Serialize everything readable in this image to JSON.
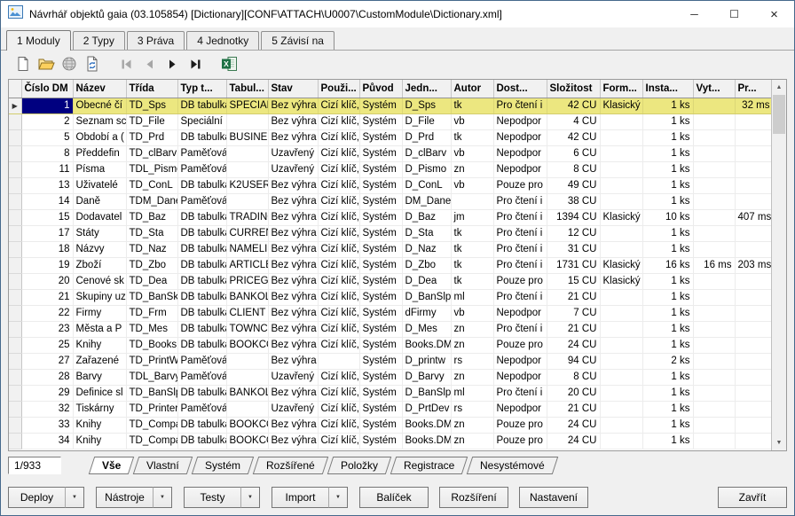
{
  "window": {
    "title": "Návrhář objektů gaia (03.105854) [Dictionary][CONF\\ATTACH\\U0007\\CustomModule\\Dictionary.xml]",
    "minimize": "─",
    "maximize": "☐",
    "close": "×"
  },
  "top_tabs": [
    {
      "label": "1 Moduly",
      "active": true
    },
    {
      "label": "2 Typy",
      "active": false
    },
    {
      "label": "3 Práva",
      "active": false
    },
    {
      "label": "4 Jednotky",
      "active": false
    },
    {
      "label": "5 Závisí na",
      "active": false
    }
  ],
  "toolbar": [
    {
      "name": "new-document-icon",
      "type": "new",
      "enabled": true
    },
    {
      "name": "open-folder-icon",
      "type": "open",
      "enabled": true
    },
    {
      "name": "globe-icon",
      "type": "globe",
      "enabled": true
    },
    {
      "name": "refresh-document-icon",
      "type": "refresh",
      "enabled": true
    },
    {
      "name": "nav-first-icon",
      "type": "first",
      "enabled": false
    },
    {
      "name": "nav-prev-icon",
      "type": "prev",
      "enabled": false
    },
    {
      "name": "nav-next-icon",
      "type": "next",
      "enabled": true
    },
    {
      "name": "nav-last-icon",
      "type": "last",
      "enabled": true
    },
    {
      "name": "excel-export-icon",
      "type": "excel",
      "enabled": true
    }
  ],
  "grid": {
    "columns": [
      {
        "label": "Číslo DM",
        "align": "right",
        "width": 58
      },
      {
        "label": "Název",
        "align": "left",
        "width": 60
      },
      {
        "label": "Třída",
        "align": "left",
        "width": 58
      },
      {
        "label": "Typ t...",
        "align": "left",
        "width": 55
      },
      {
        "label": "Tabul...",
        "align": "left",
        "width": 47
      },
      {
        "label": "Stav",
        "align": "left",
        "width": 56
      },
      {
        "label": "Použi...",
        "align": "left",
        "width": 47
      },
      {
        "label": "Původ",
        "align": "left",
        "width": 48
      },
      {
        "label": "Jedn...",
        "align": "left",
        "width": 55
      },
      {
        "label": "Autor",
        "align": "left",
        "width": 48
      },
      {
        "label": "Dost...",
        "align": "left",
        "width": 60
      },
      {
        "label": "Složitost",
        "align": "right",
        "width": 60
      },
      {
        "label": "Form...",
        "align": "left",
        "width": 48
      },
      {
        "label": "Insta...",
        "align": "right",
        "width": 57
      },
      {
        "label": "Vyt...",
        "align": "right",
        "width": 47
      },
      {
        "label": "Pr...",
        "align": "right",
        "width": 43
      }
    ],
    "selected_row": 0,
    "rows": [
      [
        "1",
        "Obecné čí",
        "TD_Sps",
        "DB tabulka",
        "SPECIALS",
        "Bez výhra",
        "Cizí klíč,Při",
        "Systém",
        "D_Sps",
        "tk",
        "Pro čtení i",
        "42 CU",
        "Klasický",
        "1 ks",
        "",
        "32 ms"
      ],
      [
        "2",
        "Seznam sc",
        "TD_File",
        "Speciální",
        "",
        "Bez výhra",
        "Cizí klíč,Při",
        "Systém",
        "D_File",
        "vb",
        "Nepodpor",
        "4 CU",
        "",
        "1 ks",
        "",
        ""
      ],
      [
        "5",
        "Období a (",
        "TD_Prd",
        "DB tabulka",
        "BUSINESS",
        "Bez výhra",
        "Cizí klíč,Při",
        "Systém",
        "D_Prd",
        "tk",
        "Nepodpor",
        "42 CU",
        "",
        "1 ks",
        "",
        ""
      ],
      [
        "8",
        "Předdefin",
        "TD_clBarv",
        "Paměťová",
        "",
        "Uzavřený",
        "Cizí klíč,Při",
        "Systém",
        "D_clBarv",
        "vb",
        "Nepodpor",
        "6 CU",
        "",
        "1 ks",
        "",
        ""
      ],
      [
        "11",
        "Písma",
        "TDL_Pismo",
        "Paměťová",
        "",
        "Uzavřený",
        "Cizí klíč,Při",
        "Systém",
        "D_Pismo",
        "zn",
        "Nepodpor",
        "8 CU",
        "",
        "1 ks",
        "",
        ""
      ],
      [
        "13",
        "Uživatelé",
        "TD_ConL",
        "DB tabulka",
        "K2USER",
        "Bez výhra",
        "Cizí klíč,Při",
        "Systém",
        "D_ConL",
        "vb",
        "Pouze pro",
        "49 CU",
        "",
        "1 ks",
        "",
        ""
      ],
      [
        "14",
        "Daně",
        "TDM_Dane",
        "Paměťová",
        "",
        "Bez výhra",
        "Cizí klíč,Při",
        "Systém",
        "DM_Dane",
        "",
        "Pro čtení i",
        "38 CU",
        "",
        "1 ks",
        "",
        ""
      ],
      [
        "15",
        "Dodavatel",
        "TD_Baz",
        "DB tabulka",
        "TRADINGF",
        "Bez výhra",
        "Cizí klíč,Při",
        "Systém",
        "D_Baz",
        "jm",
        "Pro čtení i",
        "1394 CU",
        "Klasický",
        "10 ks",
        "",
        "407 ms"
      ],
      [
        "17",
        "Státy",
        "TD_Sta",
        "DB tabulka",
        "CURRENC",
        "Bez výhra",
        "Cizí klíč,Při",
        "Systém",
        "D_Sta",
        "tk",
        "Pro čtení i",
        "12 CU",
        "",
        "1 ks",
        "",
        ""
      ],
      [
        "18",
        "Názvy",
        "TD_Naz",
        "DB tabulka",
        "NAMELIST",
        "Bez výhra",
        "Cizí klíč,Při",
        "Systém",
        "D_Naz",
        "tk",
        "Pro čtení i",
        "31 CU",
        "",
        "1 ks",
        "",
        ""
      ],
      [
        "19",
        "Zboží",
        "TD_Zbo",
        "DB tabulka",
        "ARTICLE",
        "Bez výhra",
        "Cizí klíč,Při",
        "Systém",
        "D_Zbo",
        "tk",
        "Pro čtení i",
        "1731 CU",
        "Klasický",
        "16 ks",
        "16 ms",
        "203 ms"
      ],
      [
        "20",
        "Cenové sk",
        "TD_Dea",
        "DB tabulka",
        "PRICEGRO",
        "Bez výhra",
        "Cizí klíč,Při",
        "Systém",
        "D_Dea",
        "tk",
        "Pouze pro",
        "15 CU",
        "Klasický",
        "1 ks",
        "",
        ""
      ],
      [
        "21",
        "Skupiny uz",
        "TD_BanSk",
        "DB tabulka",
        "BANKOLD",
        "Bez výhra",
        "Cizí klíč,Při",
        "Systém",
        "D_BanSlp",
        "ml",
        "Pro čtení i",
        "21 CU",
        "",
        "1 ks",
        "",
        ""
      ],
      [
        "22",
        "Firmy",
        "TD_Frm",
        "DB tabulka",
        "CLIENT",
        "Bez výhra",
        "Cizí klíč,Při",
        "Systém",
        "dFirmy",
        "vb",
        "Nepodpor",
        "7 CU",
        "",
        "1 ks",
        "",
        ""
      ],
      [
        "23",
        "Města a P",
        "TD_Mes",
        "DB tabulka",
        "TOWNCO!",
        "Bez výhra",
        "Cizí klíč,Při",
        "Systém",
        "D_Mes",
        "zn",
        "Pro čtení i",
        "21 CU",
        "",
        "1 ks",
        "",
        ""
      ],
      [
        "25",
        "Knihy",
        "TD_Books",
        "DB tabulka",
        "BOOKCON",
        "Bez výhra",
        "Cizí klíč,Při",
        "Systém",
        "Books.DM",
        "zn",
        "Pouze pro",
        "24 CU",
        "",
        "1 ks",
        "",
        ""
      ],
      [
        "27",
        "Zařazené",
        "TD_PrintW",
        "Paměťová",
        "",
        "Bez výhra",
        "",
        "Systém",
        "D_printw",
        "rs",
        "Nepodpor",
        "94 CU",
        "",
        "2 ks",
        "",
        ""
      ],
      [
        "28",
        "Barvy",
        "TDL_Barvy",
        "Paměťová",
        "",
        "Uzavřený",
        "Cizí klíč,Při",
        "Systém",
        "D_Barvy",
        "zn",
        "Nepodpor",
        "8 CU",
        "",
        "1 ks",
        "",
        ""
      ],
      [
        "29",
        "Definice sl",
        "TD_BanSlp",
        "DB tabulka",
        "BANKOLD",
        "Bez výhra",
        "Cizí klíč,Při",
        "Systém",
        "D_BanSlp",
        "ml",
        "Pro čtení i",
        "20 CU",
        "",
        "1 ks",
        "",
        ""
      ],
      [
        "32",
        "Tiskárny",
        "TD_Printer",
        "Paměťová",
        "",
        "Uzavřený",
        "Cizí klíč,Při",
        "Systém",
        "D_PrtDev",
        "rs",
        "Nepodpor",
        "21 CU",
        "",
        "1 ks",
        "",
        ""
      ],
      [
        "33",
        "Knihy",
        "TD_Compa",
        "DB tabulka",
        "BOOKCON",
        "Bez výhra",
        "Cizí klíč,Při",
        "Systém",
        "Books.DM",
        "zn",
        "Pouze pro",
        "24 CU",
        "",
        "1 ks",
        "",
        ""
      ],
      [
        "34",
        "Knihy",
        "TD_Compa",
        "DB tabulka",
        "BOOKCON",
        "Bez výhra",
        "Cizí klíč,Při",
        "Systém",
        "Books.DM",
        "zn",
        "Pouze pro",
        "24 CU",
        "",
        "1 ks",
        "",
        ""
      ]
    ]
  },
  "status": {
    "counter": "1/933"
  },
  "sheet_tabs": [
    {
      "label": "Vše",
      "active": true
    },
    {
      "label": "Vlastní",
      "active": false
    },
    {
      "label": "Systém",
      "active": false
    },
    {
      "label": "Rozšířené",
      "active": false
    },
    {
      "label": "Položky",
      "active": false
    },
    {
      "label": "Registrace",
      "active": false
    },
    {
      "label": "Nesystémové",
      "active": false
    }
  ],
  "bottom_buttons": [
    {
      "label": "Deploy",
      "dropdown": true
    },
    {
      "label": "Nástroje",
      "dropdown": true
    },
    {
      "label": "Testy",
      "dropdown": true
    },
    {
      "label": "Import",
      "dropdown": true
    },
    {
      "label": "Balíček",
      "dropdown": false
    },
    {
      "label": "Rozšíření",
      "dropdown": false
    },
    {
      "label": "Nastavení",
      "dropdown": false
    }
  ],
  "close_button": {
    "label": "Zavřít"
  },
  "colors": {
    "selected_row": "#ece780",
    "focused_cell": "#000080",
    "titlebar": "#ffffff",
    "chrome": "#f0f0f0"
  }
}
